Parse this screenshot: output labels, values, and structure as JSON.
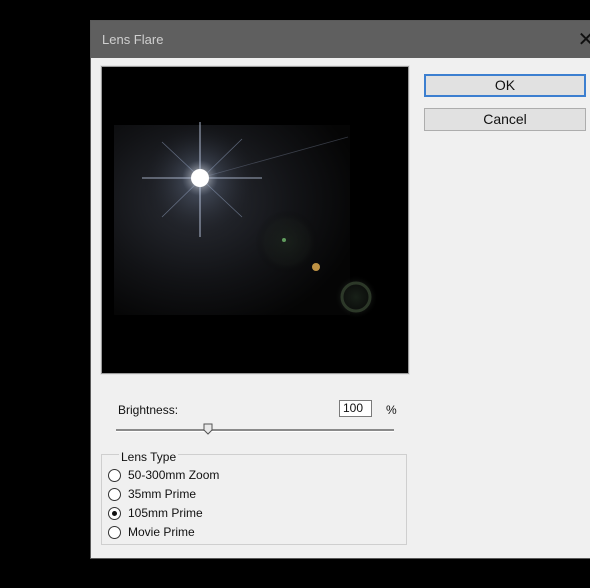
{
  "window": {
    "title": "Lens Flare",
    "close_glyph": "✕"
  },
  "buttons": {
    "ok_label": "OK",
    "cancel_label": "Cancel"
  },
  "brightness": {
    "label": "Brightness:",
    "value": "100",
    "unit": "%",
    "slider_fraction": 0.33
  },
  "lens_type": {
    "legend": "Lens Type",
    "options": [
      {
        "label": "50-300mm Zoom",
        "checked": false
      },
      {
        "label": "35mm Prime",
        "checked": false
      },
      {
        "label": "105mm Prime",
        "checked": true
      },
      {
        "label": "Movie Prime",
        "checked": false
      }
    ]
  },
  "colors": {
    "accent": "#3c7fd0",
    "dialog_bg": "#f0f0f0",
    "titlebar": "#5f5f5f"
  }
}
